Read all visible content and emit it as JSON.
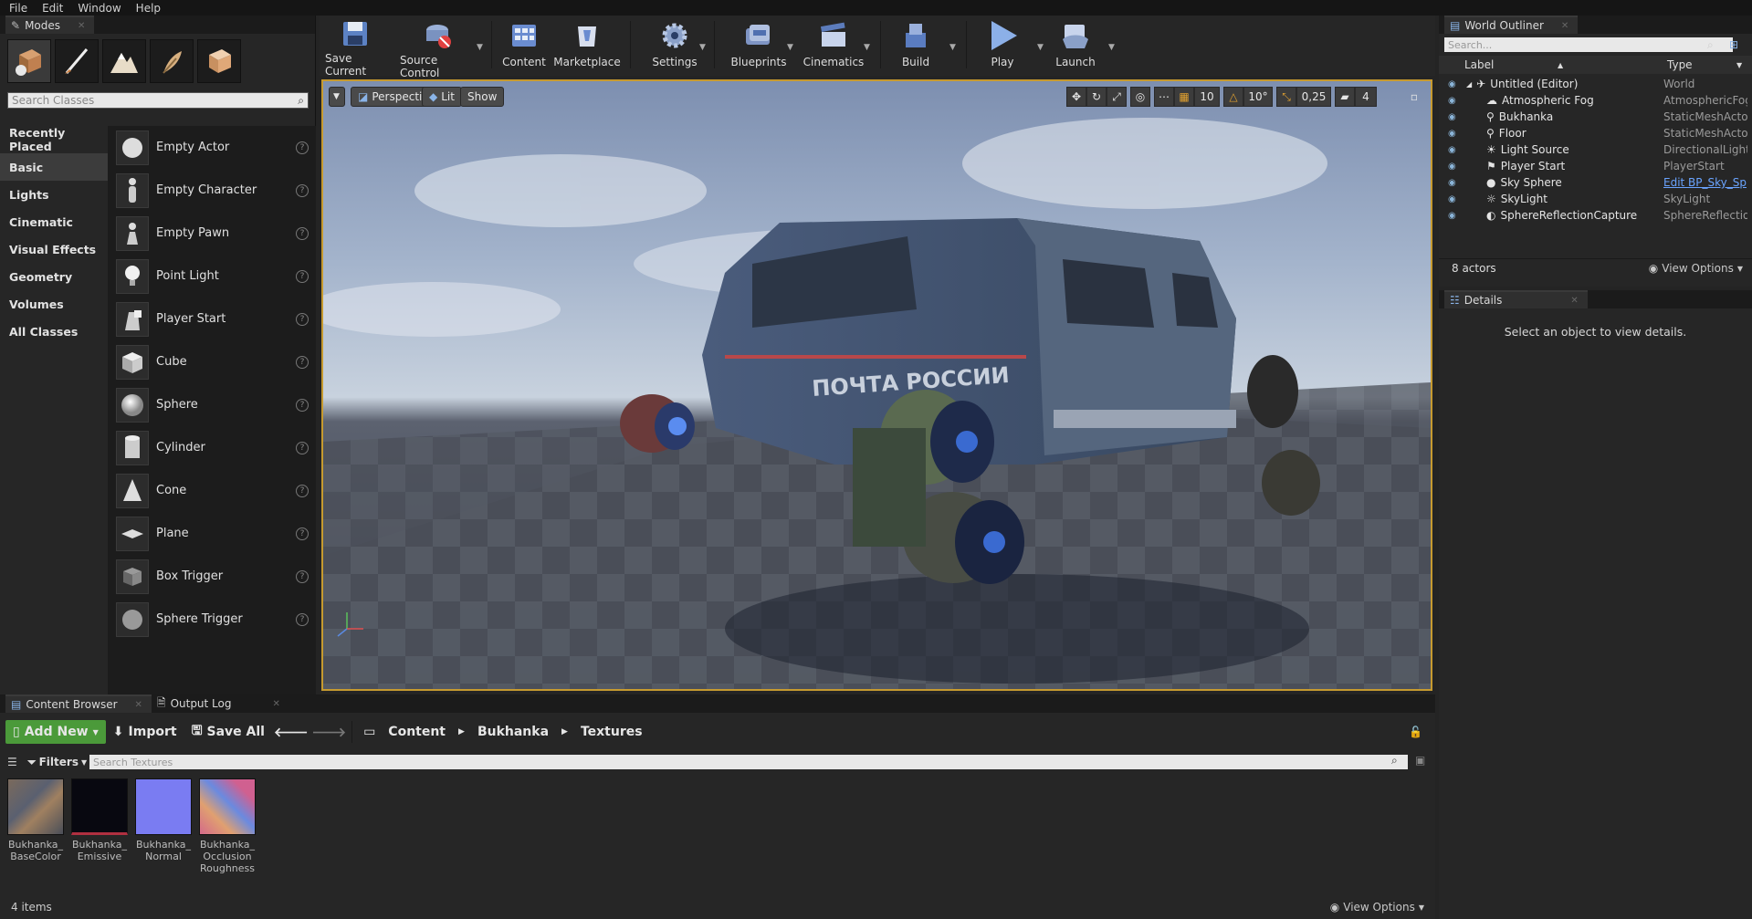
{
  "menu": [
    "File",
    "Edit",
    "Window",
    "Help"
  ],
  "modes": {
    "tab_label": "Modes",
    "search_placeholder": "Search Classes",
    "categories": [
      "Recently Placed",
      "Basic",
      "Lights",
      "Cinematic",
      "Visual Effects",
      "Geometry",
      "Volumes",
      "All Classes"
    ],
    "selected_category": "Basic",
    "items": [
      "Empty Actor",
      "Empty Character",
      "Empty Pawn",
      "Point Light",
      "Player Start",
      "Cube",
      "Sphere",
      "Cylinder",
      "Cone",
      "Plane",
      "Box Trigger",
      "Sphere Trigger"
    ]
  },
  "toolbar": {
    "buttons": [
      "Save Current",
      "Source Control",
      "Content",
      "Marketplace",
      "Settings",
      "Blueprints",
      "Cinematics",
      "Build",
      "Play",
      "Launch"
    ]
  },
  "viewport": {
    "perspective": "Perspective",
    "lit": "Lit",
    "show": "Show",
    "grid_snap": "10",
    "rot_snap": "10°",
    "scale_snap": "0,25",
    "cam_speed": "4",
    "van_text": "ПОЧТА РОССИИ"
  },
  "outliner": {
    "tab_label": "World Outliner",
    "search_placeholder": "Search...",
    "col_label": "Label",
    "col_type": "Type",
    "rows": [
      {
        "label": "Untitled (Editor)",
        "type": "World"
      },
      {
        "label": "Atmospheric Fog",
        "type": "AtmosphericFog"
      },
      {
        "label": "Bukhanka",
        "type": "StaticMeshActor"
      },
      {
        "label": "Floor",
        "type": "StaticMeshActor"
      },
      {
        "label": "Light Source",
        "type": "DirectionalLight"
      },
      {
        "label": "Player Start",
        "type": "PlayerStart"
      },
      {
        "label": "Sky Sphere",
        "type": "Edit BP_Sky_Sp"
      },
      {
        "label": "SkyLight",
        "type": "SkyLight"
      },
      {
        "label": "SphereReflectionCapture",
        "type": "SphereReflection"
      }
    ],
    "count": "8 actors",
    "view_options": "View Options"
  },
  "details": {
    "tab_label": "Details",
    "empty_text": "Select an object to view details."
  },
  "content_browser": {
    "tab_label": "Content Browser",
    "output_tab": "Output Log",
    "add_new": "Add New",
    "import": "Import",
    "save_all": "Save All",
    "path": [
      "Content",
      "Bukhanka",
      "Textures"
    ],
    "filters": "Filters",
    "search_placeholder": "Search Textures",
    "assets": [
      {
        "name": "Bukhanka_ BaseColor",
        "color": "#6b6058"
      },
      {
        "name": "Bukhanka_ Emissive",
        "color": "#0a0a14"
      },
      {
        "name": "Bukhanka_ Normal",
        "color": "#8080f0"
      },
      {
        "name": "Bukhanka_ Occlusion Roughness",
        "color": "#d46a8a"
      }
    ],
    "count": "4 items",
    "view_options": "View Options"
  }
}
